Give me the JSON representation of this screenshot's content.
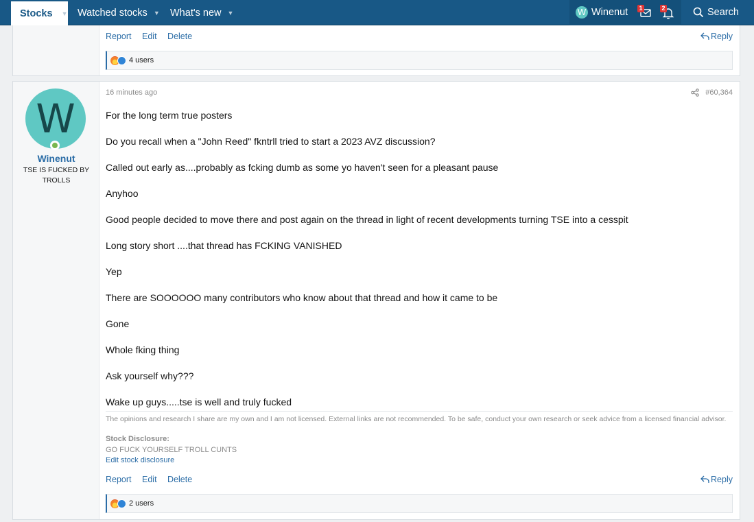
{
  "nav": {
    "tabs": [
      {
        "label": "Stocks"
      },
      {
        "label": "Watched stocks"
      },
      {
        "label": "What's new"
      }
    ],
    "user": {
      "initial": "W",
      "name": "Winenut"
    },
    "inbox_badge": "1",
    "alerts_badge": "2",
    "search_label": "Search"
  },
  "post_prev": {
    "actions": {
      "report": "Report",
      "edit": "Edit",
      "delete": "Delete",
      "reply": "Reply"
    },
    "reactions": "4 users"
  },
  "post": {
    "author": {
      "initial": "W",
      "name": "Winenut",
      "title": "TSE IS FUCKED BY TROLLS"
    },
    "time": "16 minutes ago",
    "number": "#60,364",
    "paragraphs": [
      "For the long term true posters",
      "Do you recall when a \"John Reed\" fkntrll tried to start a 2023 AVZ discussion?",
      "Called out early as....probably as fcking dumb as some yo haven't seen for a pleasant pause",
      "Anyhoo",
      "Good people decided to move there and post again on the thread in light of recent developments turning TSE into a cesspit",
      "Long story short ....that thread has FCKING VANISHED",
      "Yep",
      "There are SOOOOOO many contributors who know about that thread and how it came to be",
      "Gone",
      "Whole fking thing",
      "Ask yourself why???",
      "Wake up guys.....tse is well and truly fucked"
    ],
    "disclaimer": "The opinions and research I share are my own and I am not licensed. External links are not recommended. To be safe, conduct your own research or seek advice from a licensed financial advisor.",
    "disclosure_heading": "Stock Disclosure:",
    "disclosure_text": "GO FUCK YOURSELF TROLL CUNTS",
    "disclosure_link": "Edit stock disclosure",
    "actions": {
      "report": "Report",
      "edit": "Edit",
      "delete": "Delete",
      "reply": "Reply"
    },
    "reactions": "2 users"
  }
}
